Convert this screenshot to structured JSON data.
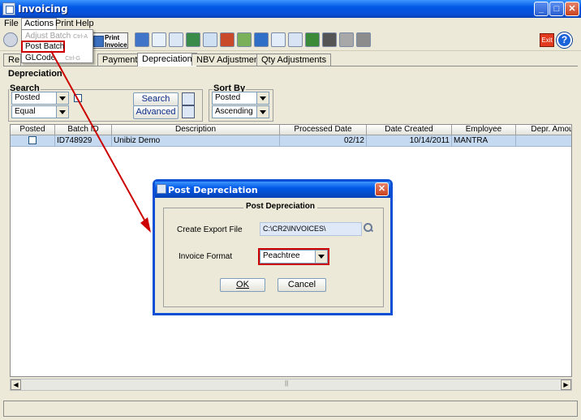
{
  "window": {
    "title": "Invoicing"
  },
  "menu": {
    "file": "File",
    "actions": "Actions",
    "print": "Print",
    "help": "Help"
  },
  "actions_menu": {
    "items": [
      {
        "label": "Adjust Batch",
        "shortcut": "Ctrl-A",
        "enabled": false
      },
      {
        "label": "Post Batch",
        "shortcut": "",
        "enabled": true
      },
      {
        "label": "GLCode",
        "shortcut": "Ctrl-G",
        "enabled": true
      }
    ]
  },
  "toolbar": {
    "print_invoice_line1": "Print",
    "print_invoice_line2": "Invoice",
    "exit": "Exit",
    "help": "?"
  },
  "tabs": [
    "Re",
    "Payments",
    "Depreciation",
    "NBV Adjustments",
    "Qty Adjustments"
  ],
  "selected_tab": "Depreciation",
  "section_title": "Depreciation",
  "search": {
    "label": "Search",
    "field": "Posted",
    "operator": "Equal",
    "search_button": "Search",
    "advanced_button": "Advanced"
  },
  "sort_by": {
    "label": "Sort By",
    "field": "Posted",
    "direction": "Ascending"
  },
  "grid": {
    "columns": [
      "Posted",
      "Batch ID",
      "Description",
      "Processed Date",
      "Date Created",
      "Employee",
      "Depr. Amou"
    ],
    "rows": [
      {
        "posted": false,
        "batch_id": "ID748929",
        "description": "Unibiz Demo",
        "processed_date": "02/12",
        "date_created": "10/14/2011",
        "employee": "MANTRA",
        "depr_amount": ""
      }
    ]
  },
  "scroll_marker": "||",
  "dialog": {
    "title": "Post Depreciation",
    "group_label": "Post Depreciation",
    "export_label": "Create Export File",
    "export_path": "C:\\CR2\\INVOICES\\",
    "format_label": "Invoice Format",
    "format_value": "Peachtree",
    "ok": "OK",
    "cancel": "Cancel"
  },
  "colors": {
    "annotation": "#cc0000",
    "title_bar": "#0058e6",
    "selected_row": "#c5d9f1"
  }
}
